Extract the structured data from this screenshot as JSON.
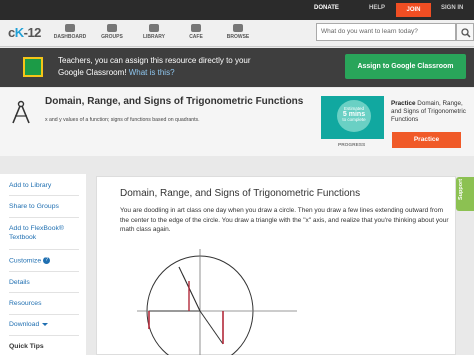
{
  "topbar": {
    "donate": "DONATE",
    "help": "HELP",
    "join": "JOIN",
    "signin": "SIGN IN"
  },
  "brand": {
    "logo_prefix": "c",
    "logo_k": "K",
    "logo_suffix": "-12"
  },
  "nav": {
    "items": [
      {
        "label": "DASHBOARD",
        "icon": "dashboard-icon"
      },
      {
        "label": "GROUPS",
        "icon": "groups-icon"
      },
      {
        "label": "LIBRARY",
        "icon": "library-icon"
      },
      {
        "label": "CAFE",
        "icon": "cafe-icon"
      },
      {
        "label": "BROWSE",
        "icon": "browse-icon"
      }
    ],
    "search_placeholder": "What do you want to learn today?"
  },
  "classroom": {
    "text": "Teachers, you can assign this resource directly to your Google Classroom!",
    "link": "What is this?",
    "button": "Assign to Google Classroom"
  },
  "header": {
    "title": "Domain, Range, and Signs of Trigonometric Functions",
    "subtitle": "x and y values of a function; signs of functions based on quadrants.",
    "thumb_line1": "Estimated",
    "thumb_line2": "5 mins",
    "thumb_line3": "to complete",
    "progress": "PROGRESS",
    "practice_prefix": "Practice",
    "practice_title": "Domain, Range, and Signs of Trigonometric Functions",
    "practice_button": "Practice"
  },
  "sidebar": {
    "items": [
      {
        "label": "Add to Library"
      },
      {
        "label": "Share to Groups"
      },
      {
        "label": "Add to FlexBook® Textbook"
      },
      {
        "label": "Customize"
      },
      {
        "label": "Details"
      },
      {
        "label": "Resources"
      },
      {
        "label": "Download"
      },
      {
        "label": "Quick Tips"
      }
    ]
  },
  "content": {
    "title": "Domain, Range, and Signs of Trigonometric Functions",
    "paragraph": "You are doodling in art class one day when you draw a circle. Then you draw a few lines extending outward from the center to the edge of the circle. You draw a triangle with the \"x\" axis, and realize that you're thinking about your math class again."
  },
  "support": {
    "label": "Support"
  },
  "colors": {
    "accent_orange": "#f04e23",
    "classroom_green": "#29a55a",
    "link_blue": "#1f6fb1",
    "support_green": "#8cc152"
  }
}
